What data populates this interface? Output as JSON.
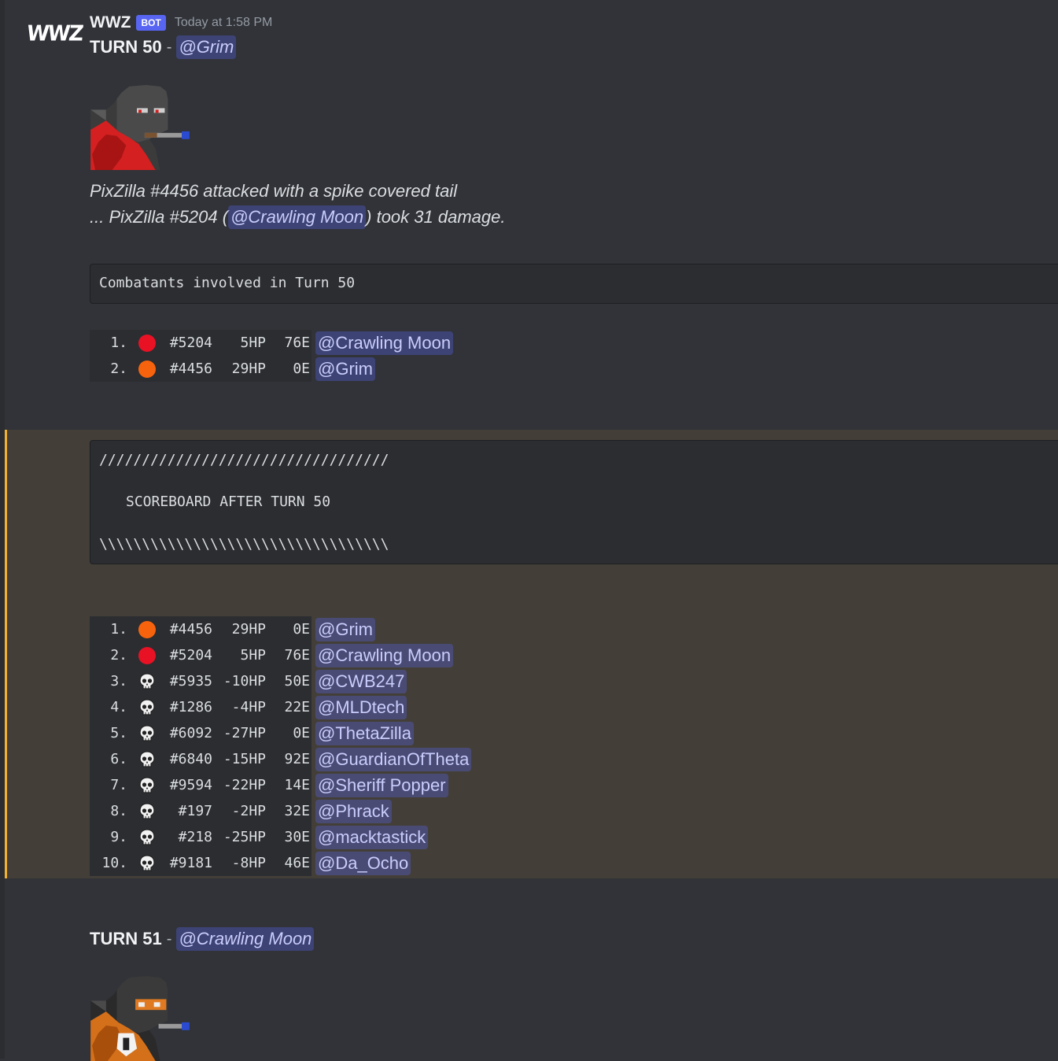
{
  "message": {
    "author": "WWZ",
    "avatar_text": "WWZ",
    "bot_tag": "BOT",
    "timestamp": "Today at 1:58 PM"
  },
  "turn50": {
    "label": "TURN 50",
    "separator": "-",
    "mention": "@Grim",
    "sprite_icon": "pixzilla-sprite-red",
    "action_line1": "PixZilla #4456 attacked with a spike covered tail",
    "action_line2_prefix": "... PixZilla #5204 (",
    "action_line2_mention": "@Crawling Moon",
    "action_line2_suffix": ") took 31 damage.",
    "combatants_header": "Combatants involved in Turn 50",
    "combatants": [
      {
        "num": "1.",
        "status": "red-dot",
        "color": "#e81224",
        "id": "#5204",
        "hp": "5HP",
        "energy": "76E",
        "mention": "@Crawling Moon"
      },
      {
        "num": "2.",
        "status": "orange-dot",
        "color": "#f7630c",
        "id": "#4456",
        "hp": "29HP",
        "energy": "0E",
        "mention": "@Grim"
      }
    ]
  },
  "scoreboard": {
    "slash_line": "//////////////////////////////////",
    "title": "SCOREBOARD AFTER TURN 50",
    "backslash_line": "\\\\\\\\\\\\\\\\\\\\\\\\\\\\\\\\\\\\\\\\\\\\\\\\\\\\\\\\\\\\\\\\\\\\",
    "accent_color": "#f0b232",
    "rows": [
      {
        "num": "1.",
        "status": "orange-dot",
        "color": "#f7630c",
        "id": "#4456",
        "hp": "29HP",
        "energy": "0E",
        "mention": "@Grim"
      },
      {
        "num": "2.",
        "status": "red-dot",
        "color": "#e81224",
        "id": "#5204",
        "hp": "5HP",
        "energy": "76E",
        "mention": "@Crawling Moon"
      },
      {
        "num": "3.",
        "status": "skull",
        "id": "#5935",
        "hp": "-10HP",
        "energy": "50E",
        "mention": "@CWB247"
      },
      {
        "num": "4.",
        "status": "skull",
        "id": "#1286",
        "hp": "-4HP",
        "energy": "22E",
        "mention": "@MLDtech"
      },
      {
        "num": "5.",
        "status": "skull",
        "id": "#6092",
        "hp": "-27HP",
        "energy": "0E",
        "mention": "@ThetaZilla"
      },
      {
        "num": "6.",
        "status": "skull",
        "id": "#6840",
        "hp": "-15HP",
        "energy": "92E",
        "mention": "@GuardianOfTheta"
      },
      {
        "num": "7.",
        "status": "skull",
        "id": "#9594",
        "hp": "-22HP",
        "energy": "14E",
        "mention": "@Sheriff Popper"
      },
      {
        "num": "8.",
        "status": "skull",
        "id": "#197",
        "hp": "-2HP",
        "energy": "32E",
        "mention": "@Phrack"
      },
      {
        "num": "9.",
        "status": "skull",
        "id": "#218",
        "hp": "-25HP",
        "energy": "30E",
        "mention": "@macktastick"
      },
      {
        "num": "10.",
        "status": "skull",
        "id": "#9181",
        "hp": "-8HP",
        "energy": "46E",
        "mention": "@Da_Ocho"
      }
    ]
  },
  "turn51": {
    "label": "TURN 51",
    "separator": "-",
    "mention": "@Crawling Moon",
    "sprite_icon": "pixzilla-sprite-orange"
  }
}
